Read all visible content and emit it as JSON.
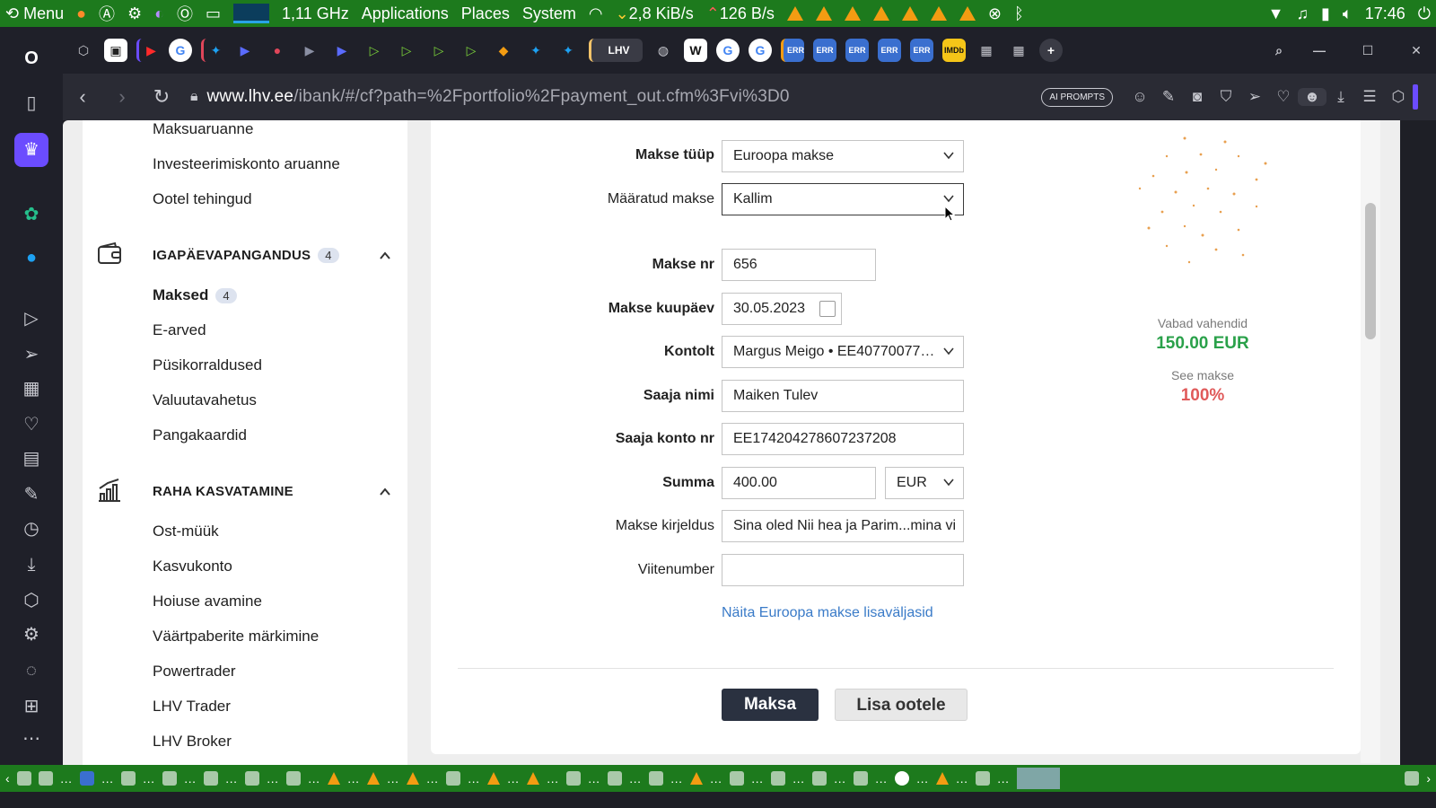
{
  "system_panel": {
    "menu_label": "Menu",
    "cpu_freq": "1,11 GHz",
    "applications": "Applications",
    "places": "Places",
    "system": "System",
    "net_down": "2,8 KiB/s",
    "net_up": "126 B/s",
    "clock": "17:46"
  },
  "browser": {
    "url_host": "www.lhv.ee",
    "url_path": "/ibank/#/cf?path=%2Fportfolio%2Fpayment_out.cfm%3Fvi%3D0",
    "ai_prompts": "AI PROMPTS"
  },
  "sidebar": {
    "top_items": [
      "Maksuaruanne",
      "Investeerimiskonto aruanne",
      "Ootel tehingud"
    ],
    "section1": {
      "title": "IGAPÄEVAPANGANDUS",
      "count": "4",
      "items": [
        {
          "label": "Maksed",
          "count": "4"
        },
        {
          "label": "E-arved"
        },
        {
          "label": "Püsikorraldused"
        },
        {
          "label": "Valuutavahetus"
        },
        {
          "label": "Pangakaardid"
        }
      ]
    },
    "section2": {
      "title": "RAHA KASVATAMINE",
      "items": [
        "Ost-müük",
        "Kasvukonto",
        "Hoiuse avamine",
        "Väärtpaberite märkimine",
        "Powertrader",
        "LHV Trader",
        "LHV Broker"
      ]
    }
  },
  "form": {
    "payment_type": {
      "label": "Makse tüüp",
      "value": "Euroopa makse"
    },
    "template": {
      "label": "Määratud makse",
      "value": "Kallim"
    },
    "payment_nr": {
      "label": "Makse nr",
      "value": "656"
    },
    "payment_date": {
      "label": "Makse kuupäev",
      "value": "30.05.2023"
    },
    "account": {
      "label": "Kontolt",
      "value": "Margus Meigo • EE40770077…"
    },
    "recipient_name": {
      "label": "Saaja nimi",
      "value": "Maiken Tulev"
    },
    "recipient_account": {
      "label": "Saaja konto nr",
      "value": "EE174204278607237208"
    },
    "amount": {
      "label": "Summa",
      "value": "400.00",
      "currency": "EUR"
    },
    "description": {
      "label": "Makse kirjeldus",
      "value": "Sina oled Nii hea ja Parim...mina vi"
    },
    "reference": {
      "label": "Viitenumber",
      "value": ""
    },
    "extra_fields_link": "Näita Euroopa makse lisaväljasid",
    "pay_button": "Maksa",
    "queue_button": "Lisa ootele"
  },
  "side_info": {
    "free_funds_label": "Vabad vahendid",
    "free_funds_value": "150.00 EUR",
    "see_payment_label": "See makse",
    "see_payment_value": "100%"
  },
  "colors": {
    "panel_green": "#1d7a1d",
    "funds_green": "#2aa14a",
    "percent_red": "#e05a5a",
    "link_blue": "#3a7bc8",
    "primary_button": "#2a3140"
  }
}
